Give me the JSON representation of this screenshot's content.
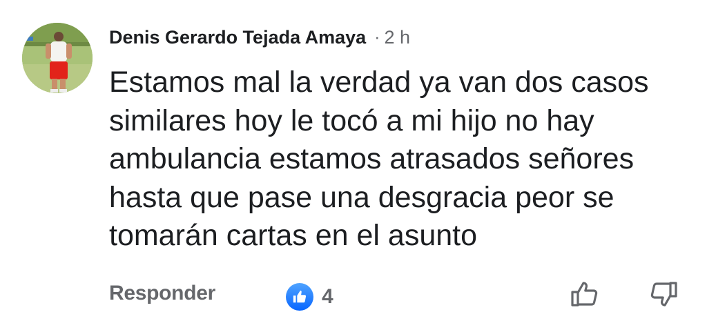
{
  "comment": {
    "author": "Denis Gerardo Tejada Amaya",
    "separator": "·",
    "time": "2 h",
    "text_lines": [
      "Estamos mal la verdad ya van dos casos",
      "similares hoy le tocó a mi hijo no hay",
      "ambulancia estamos atrasados señores",
      "hasta que pase una desgracia peor se",
      "tomarán cartas en el asunto"
    ]
  },
  "actions": {
    "reply_label": "Responder",
    "reaction_count": "4",
    "reaction_icon": "like-reaction-icon",
    "upvote_icon": "thumbs-up-outline-icon",
    "downvote_icon": "thumbs-down-outline-icon"
  },
  "colors": {
    "primary_text": "#1c1e21",
    "secondary_text": "#65676b",
    "like_blue": "#0866ff"
  }
}
